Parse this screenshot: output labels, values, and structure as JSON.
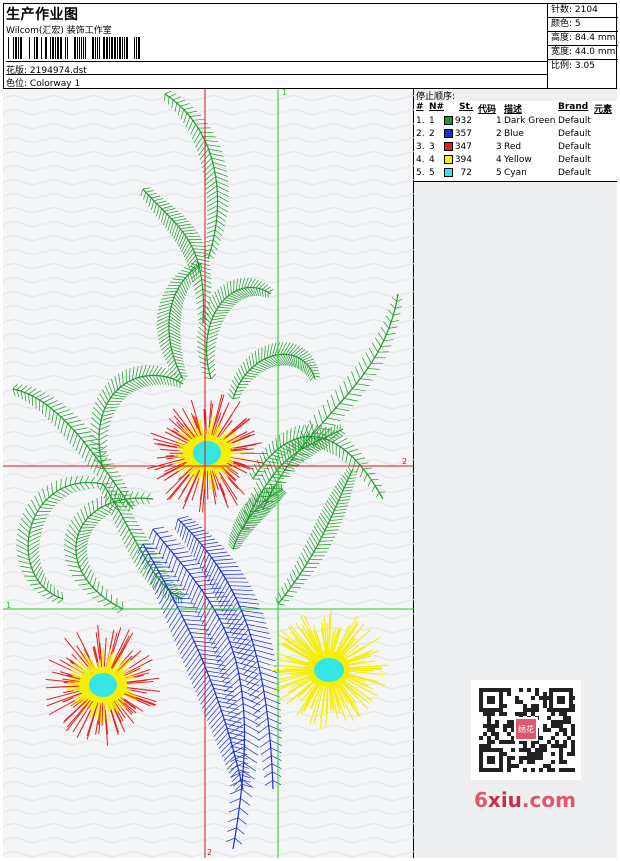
{
  "header": {
    "title": "生产作业图",
    "studio": "Wilcom(汇宏) 装饰工作室",
    "design_label": "花版:",
    "design_value": "2194974.dst",
    "colorway_label": "色位:",
    "colorway_value": "Colorway 1"
  },
  "stats": {
    "stitches_label": "针数:",
    "stitches": "2104",
    "colors_label": "颜色:",
    "colors": "5",
    "height_label": "高度:",
    "height": "84.4 mm",
    "width_label": "宽度:",
    "width": "44.0 mm",
    "scale_label": "比例:",
    "scale": "3.05"
  },
  "sequence": {
    "title": "停止顺序:",
    "headers": [
      "#",
      "N#",
      "St.",
      "代码",
      "描述",
      "Brand",
      "元素"
    ],
    "rows": [
      {
        "idx": "1.",
        "n": "1",
        "st": "932",
        "code": "1",
        "desc": "Dark Green",
        "brand": "Default",
        "color": "#1f9a2a"
      },
      {
        "idx": "2.",
        "n": "2",
        "st": "357",
        "code": "2",
        "desc": "Blue",
        "brand": "Default",
        "color": "#1a2ed8"
      },
      {
        "idx": "3.",
        "n": "3",
        "st": "347",
        "code": "3",
        "desc": "Red",
        "brand": "Default",
        "color": "#e81e1e"
      },
      {
        "idx": "4.",
        "n": "4",
        "st": "394",
        "code": "4",
        "desc": "Yellow",
        "brand": "Default",
        "color": "#f7ef00"
      },
      {
        "idx": "5.",
        "n": "5",
        "st": "72",
        "code": "5",
        "desc": "Cyan",
        "brand": "Default",
        "color": "#34e6e6"
      }
    ]
  },
  "guides": {
    "vertical_1_label": "1",
    "horizontal_2_label": "2",
    "horizontal_1_label": "1",
    "vertical_2_label": "2"
  },
  "watermark": {
    "prefix": "6",
    "mid": "xiu",
    "suffix": ".com",
    "stamp": "绣花"
  },
  "colors": {
    "green": "#1f9a2a",
    "blue": "#1a2ed8",
    "red": "#e81e1e",
    "yellow": "#f7ef00",
    "cyan": "#34e6e6",
    "guide_green": "#17d317",
    "guide_red": "#e01414"
  }
}
